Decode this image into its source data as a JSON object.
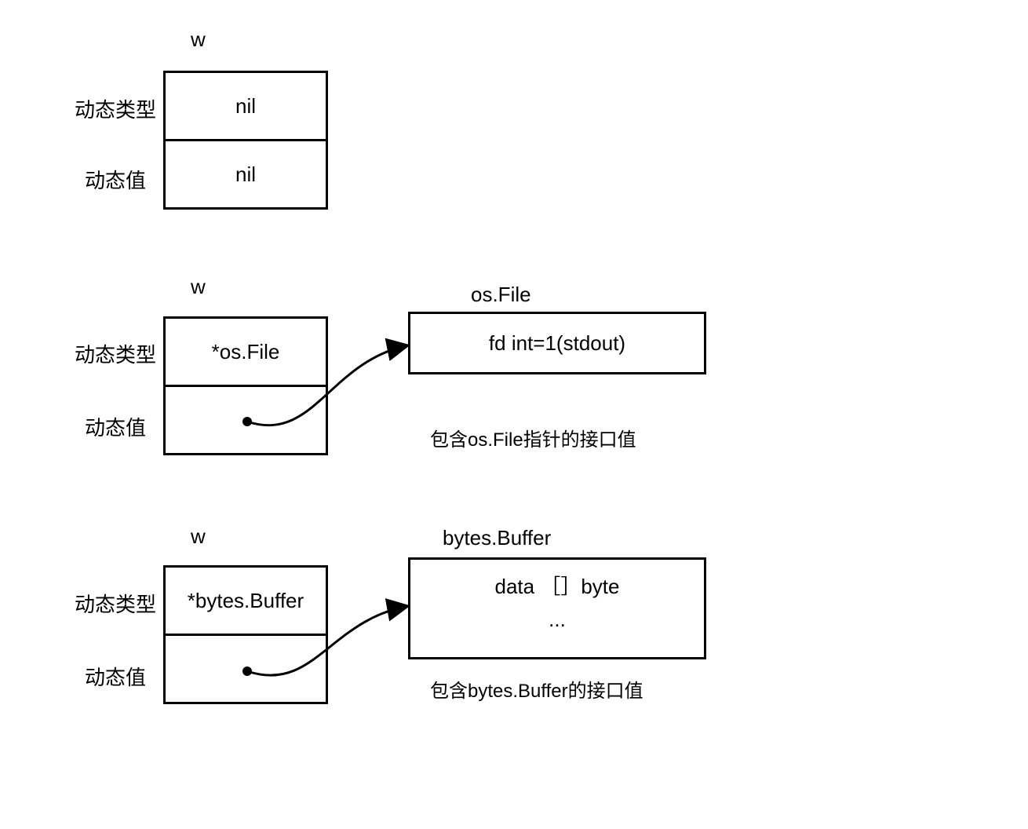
{
  "diagram": {
    "block1": {
      "title": "w",
      "row_type_label": "动态类型",
      "row_type_value": "nil",
      "row_value_label": "动态值",
      "row_value_value": "nil"
    },
    "block2": {
      "title": "w",
      "row_type_label": "动态类型",
      "row_type_value": "*os.File",
      "row_value_label": "动态值",
      "target_title": "os.File",
      "target_content": "fd int=1(stdout)",
      "caption": "包含os.File指针的接口值"
    },
    "block3": {
      "title": "w",
      "row_type_label": "动态类型",
      "row_type_value": "*bytes.Buffer",
      "row_value_label": "动态值",
      "target_title": "bytes.Buffer",
      "target_content_line1": "data ［］byte",
      "target_content_line2": "...",
      "caption": "包含bytes.Buffer的接口值"
    }
  }
}
